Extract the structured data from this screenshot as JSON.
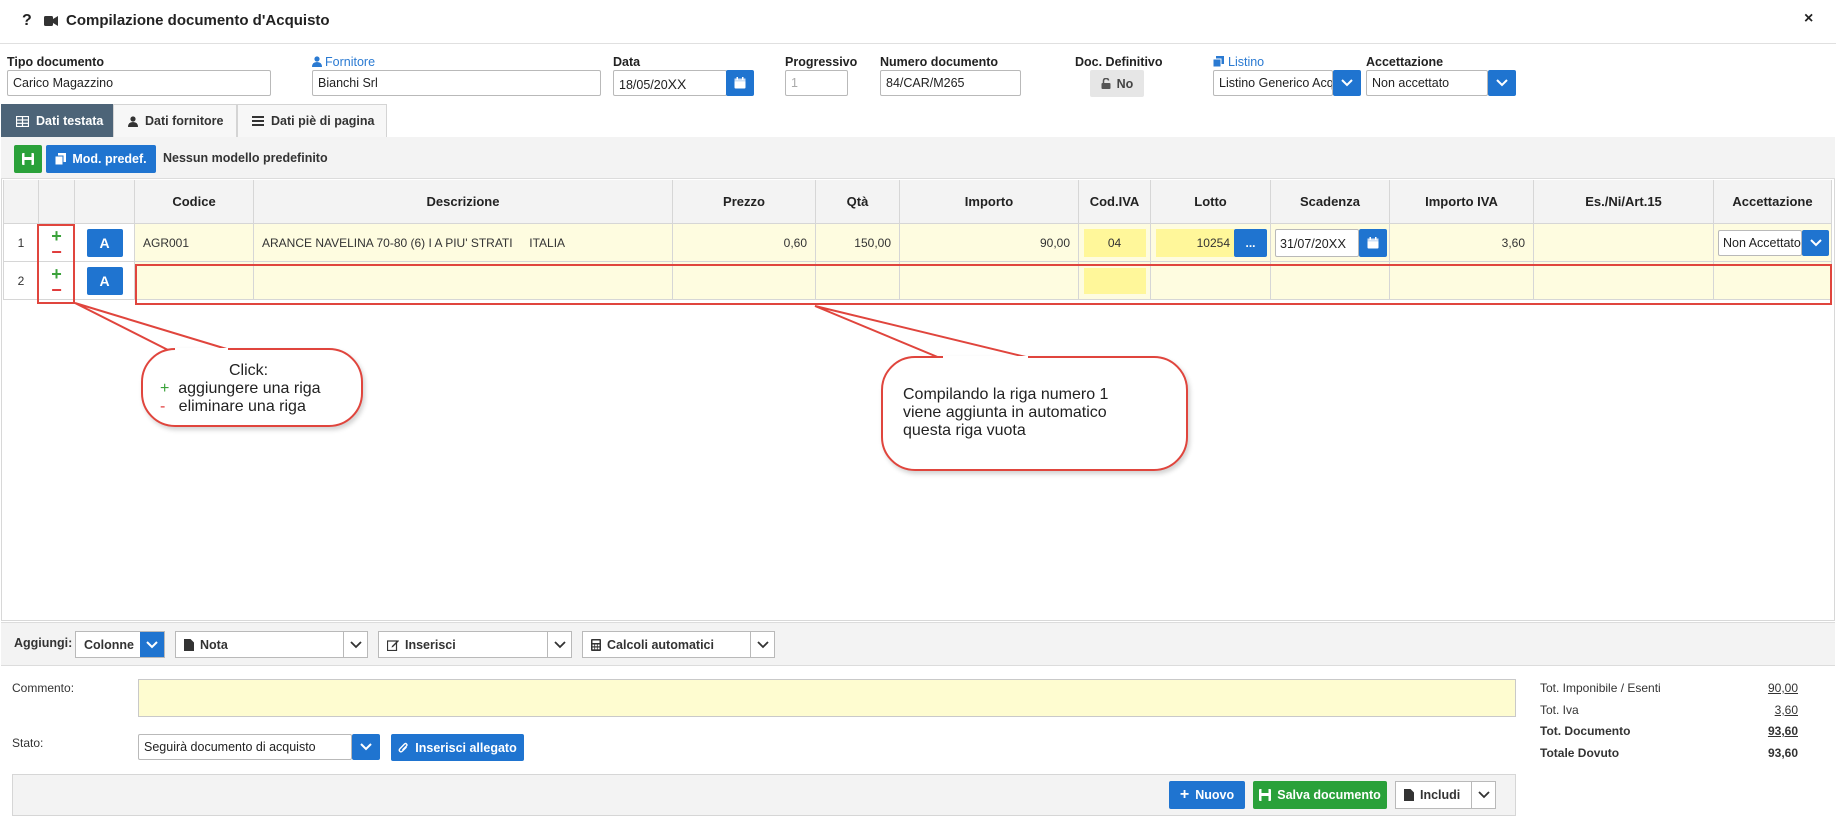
{
  "window": {
    "help": "?",
    "title": "Compilazione documento d'Acquisto",
    "close": "×"
  },
  "header": {
    "tipo": {
      "label": "Tipo documento",
      "value": "Carico Magazzino"
    },
    "fornitore": {
      "label": "Fornitore",
      "value": "Bianchi Srl"
    },
    "data": {
      "label": "Data",
      "value": "18/05/20",
      "suffix": "XX"
    },
    "progressivo": {
      "label": "Progressivo",
      "value": "1"
    },
    "numero": {
      "label": "Numero documento",
      "value": "84/CAR/M265"
    },
    "definitivo": {
      "label": "Doc. Definitivo",
      "value": "No"
    },
    "listino": {
      "label": "Listino",
      "value": "Listino Generico Acq"
    },
    "accettazione": {
      "label": "Accettazione",
      "value": "Non accettato"
    }
  },
  "tabs": [
    {
      "label": "Dati testata",
      "icon": "table-icon"
    },
    {
      "label": "Dati fornitore",
      "icon": "user-icon"
    },
    {
      "label": "Dati piè di pagina",
      "icon": "list-icon"
    }
  ],
  "toolbar": {
    "mod_label": "Mod. predef.",
    "modello_text": "Nessun modello predefinito"
  },
  "grid": {
    "columns": [
      "Codice",
      "Descrizione",
      "Prezzo",
      "Qtà",
      "Importo",
      "Cod.IVA",
      "Lotto",
      "Scadenza",
      "Importo IVA",
      "Es./Ni/Art.15",
      "Accettazione"
    ],
    "rows": [
      {
        "num": "1",
        "btn": "A",
        "codice": "AGR001",
        "descrizione": "ARANCE NAVELINA 70-80 (6) I A PIU' STRATI     ITALIA",
        "prezzo": "0,60",
        "qta": "150,00",
        "importo": "90,00",
        "codiva": "04",
        "lotto": "10254",
        "lotto_btn": "...",
        "scadenza": "31/07/20",
        "scadenza_suffix": "XX",
        "importo_iva": "3,60",
        "esenzione": "",
        "accettazione": "Non Accettato"
      },
      {
        "num": "2",
        "btn": "A"
      }
    ],
    "plus": "+",
    "minus": "−"
  },
  "callouts": {
    "left": {
      "title": "Click:",
      "plus_sym": "+",
      "plus_text": "aggiungere una riga",
      "minus_sym": "-",
      "minus_text": "eliminare una riga"
    },
    "right": {
      "line1": "Compilando la riga numero 1",
      "line2": "viene aggiunta in automatico",
      "line3": "questa riga vuota"
    }
  },
  "addbar": {
    "label": "Aggiungi:",
    "colonne": "Colonne",
    "nota": "Nota",
    "inserisci": "Inserisci",
    "calcoli": "Calcoli automatici"
  },
  "footer": {
    "commento_label": "Commento:",
    "stato_label": "Stato:",
    "stato_value": "Seguirà documento di acquisto",
    "allegato": "Inserisci allegato",
    "nuovo": "Nuovo",
    "salva": "Salva documento",
    "includi": "Includi"
  },
  "totals": [
    {
      "label": "Tot. Imponibile / Esenti",
      "value": "90,00",
      "bold": false
    },
    {
      "label": "Tot. Iva",
      "value": "3,60",
      "bold": false
    },
    {
      "label": "Tot. Documento",
      "value": "93,60",
      "bold": true
    },
    {
      "label": "Totale Dovuto",
      "value": "93,60",
      "bold": true
    }
  ],
  "colors": {
    "accent": "#1f74d0",
    "tab_active": "#4d6478",
    "highlight_yellow": "#fefce0",
    "annotation_red": "#e0453d",
    "success_green": "#2aa13a"
  }
}
